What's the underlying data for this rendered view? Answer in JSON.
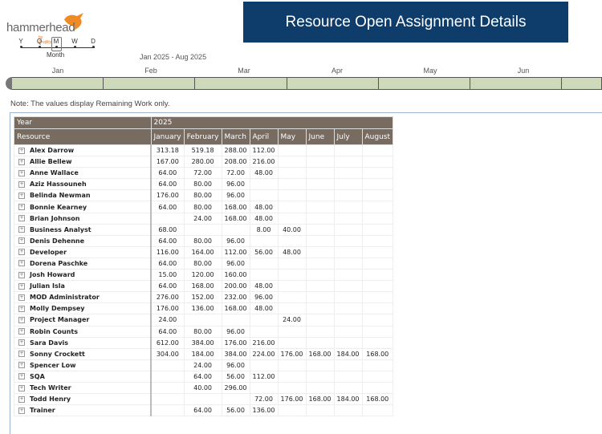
{
  "logo": {
    "name": "hammerhead",
    "by": "by Projility"
  },
  "scale": {
    "levels": [
      "Y",
      "Q",
      "M",
      "W",
      "D"
    ],
    "selected_label": "Month"
  },
  "date_range": "Jan 2025 - Aug 2025",
  "title": "Resource Open Assignment Details",
  "timeline_months": [
    "Jan",
    "Feb",
    "Mar",
    "Apr",
    "May",
    "Jun"
  ],
  "note": "Note: The values display Remaining Work only.",
  "table": {
    "year_label": "Year",
    "year": "2025",
    "resource_label": "Resource",
    "months": [
      "January",
      "February",
      "March",
      "April",
      "May",
      "June",
      "July",
      "August"
    ],
    "rows": [
      {
        "name": "Alex Darrow",
        "values": [
          "313.18",
          "519.18",
          "288.00",
          "112.00",
          "",
          "",
          "",
          ""
        ]
      },
      {
        "name": "Allie Bellew",
        "values": [
          "167.00",
          "280.00",
          "208.00",
          "216.00",
          "",
          "",
          "",
          ""
        ]
      },
      {
        "name": "Anne Wallace",
        "values": [
          "64.00",
          "72.00",
          "72.00",
          "48.00",
          "",
          "",
          "",
          ""
        ]
      },
      {
        "name": "Aziz Hassouneh",
        "values": [
          "64.00",
          "80.00",
          "96.00",
          "",
          "",
          "",
          "",
          ""
        ]
      },
      {
        "name": "Belinda Newman",
        "values": [
          "176.00",
          "80.00",
          "96.00",
          "",
          "",
          "",
          "",
          ""
        ]
      },
      {
        "name": "Bonnie Kearney",
        "values": [
          "64.00",
          "80.00",
          "168.00",
          "48.00",
          "",
          "",
          "",
          ""
        ]
      },
      {
        "name": "Brian Johnson",
        "values": [
          "",
          "24.00",
          "168.00",
          "48.00",
          "",
          "",
          "",
          ""
        ]
      },
      {
        "name": "Business Analyst",
        "values": [
          "68.00",
          "",
          "",
          "8.00",
          "40.00",
          "",
          "",
          ""
        ]
      },
      {
        "name": "Denis Dehenne",
        "values": [
          "64.00",
          "80.00",
          "96.00",
          "",
          "",
          "",
          "",
          ""
        ]
      },
      {
        "name": "Developer",
        "values": [
          "116.00",
          "164.00",
          "112.00",
          "56.00",
          "48.00",
          "",
          "",
          ""
        ]
      },
      {
        "name": "Dorena Paschke",
        "values": [
          "64.00",
          "80.00",
          "96.00",
          "",
          "",
          "",
          "",
          ""
        ]
      },
      {
        "name": "Josh Howard",
        "values": [
          "15.00",
          "120.00",
          "160.00",
          "",
          "",
          "",
          "",
          ""
        ]
      },
      {
        "name": "Julian Isla",
        "values": [
          "64.00",
          "168.00",
          "200.00",
          "48.00",
          "",
          "",
          "",
          ""
        ]
      },
      {
        "name": "MOD Administrator",
        "values": [
          "276.00",
          "152.00",
          "232.00",
          "96.00",
          "",
          "",
          "",
          ""
        ]
      },
      {
        "name": "Molly Dempsey",
        "values": [
          "176.00",
          "136.00",
          "168.00",
          "48.00",
          "",
          "",
          "",
          ""
        ]
      },
      {
        "name": "Project Manager",
        "values": [
          "24.00",
          "",
          "",
          "",
          "24.00",
          "",
          "",
          ""
        ]
      },
      {
        "name": "Robin Counts",
        "values": [
          "64.00",
          "80.00",
          "96.00",
          "",
          "",
          "",
          "",
          ""
        ]
      },
      {
        "name": "Sara Davis",
        "values": [
          "612.00",
          "384.00",
          "176.00",
          "216.00",
          "",
          "",
          "",
          ""
        ]
      },
      {
        "name": "Sonny Crockett",
        "values": [
          "304.00",
          "184.00",
          "384.00",
          "224.00",
          "176.00",
          "168.00",
          "184.00",
          "168.00"
        ]
      },
      {
        "name": "Spencer Low",
        "values": [
          "",
          "24.00",
          "96.00",
          "",
          "",
          "",
          "",
          ""
        ]
      },
      {
        "name": "SQA",
        "values": [
          "",
          "64.00",
          "56.00",
          "112.00",
          "",
          "",
          "",
          ""
        ]
      },
      {
        "name": "Tech Writer",
        "values": [
          "",
          "40.00",
          "296.00",
          "",
          "",
          "",
          "",
          ""
        ]
      },
      {
        "name": "Todd Henry",
        "values": [
          "",
          "",
          "",
          "72.00",
          "176.00",
          "168.00",
          "184.00",
          "168.00"
        ]
      },
      {
        "name": "Trainer",
        "values": [
          "",
          "64.00",
          "56.00",
          "136.00",
          "",
          "",
          "",
          ""
        ]
      }
    ]
  }
}
